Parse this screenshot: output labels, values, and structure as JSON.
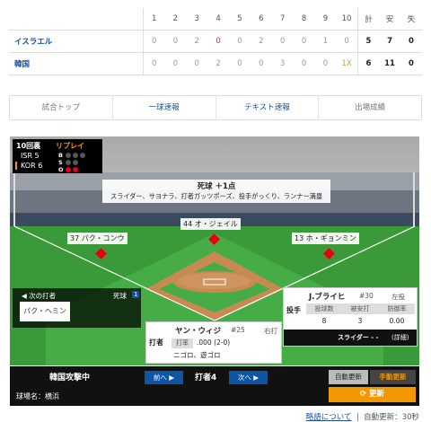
{
  "scoreboard": {
    "innings": [
      "1",
      "2",
      "3",
      "4",
      "5",
      "6",
      "7",
      "8",
      "9",
      "10"
    ],
    "totals_header": [
      "計",
      "安",
      "失"
    ],
    "rows": [
      {
        "team": "イスラエル",
        "scores": [
          "0",
          "0",
          "2",
          "0",
          "0",
          "2",
          "0",
          "0",
          "1",
          "0"
        ],
        "totals": [
          "5",
          "7",
          "0"
        ]
      },
      {
        "team": "韓国",
        "scores": [
          "0",
          "0",
          "0",
          "2",
          "0",
          "0",
          "3",
          "0",
          "0",
          "1X"
        ],
        "totals": [
          "6",
          "11",
          "0"
        ]
      }
    ]
  },
  "nav": {
    "tabs": [
      "試合トップ",
      "一球速報",
      "テキスト速報",
      "出場成績"
    ]
  },
  "field": {
    "inning_label": "10回裏",
    "replay_label": "リプレイ",
    "teams": [
      {
        "abbr": "ISR",
        "runs": "5"
      },
      {
        "abbr": "KOR",
        "runs": "6"
      }
    ],
    "count_labels": [
      "B",
      "S",
      "O"
    ],
    "count": {
      "balls": 0,
      "strikes": 0,
      "outs": 2
    },
    "play_result": "死球 ＋1点",
    "play_detail": "スライダー、サヨナラ、打者ガッツポーズ、投手がっくり、ランナー満塁",
    "runners": {
      "second": "44 オ・ジェイル",
      "first": "13 ホ・ギョンミン",
      "third": "37 パク・コンウ"
    }
  },
  "next_batter": {
    "label": "次の打者",
    "result_label": "死球",
    "result_count": "1",
    "name": "パク・ヘミン"
  },
  "pitcher": {
    "role": "投手",
    "name": "J.ブライヒ",
    "number": "#30",
    "throws": "左投",
    "stat_headers": [
      "投球数",
      "被安打",
      "防御率"
    ],
    "stats": [
      "8",
      "3",
      "0.00"
    ],
    "pitch_type": "スライダー - -",
    "detail": "(詳細)"
  },
  "batter": {
    "role": "打者",
    "name": "ヤン・ウィジ",
    "number": "#25",
    "bats": "右打",
    "avg_label": "打率",
    "avg": ".000 (2-0)",
    "results": "ニゴロ、遊ゴロ"
  },
  "bottom_bar": {
    "attack": "韓国攻撃中",
    "prev": "前へ",
    "batter_no": "打者4",
    "next": "次へ",
    "stadium": "球場名：横浜",
    "auto_update": "自動更新",
    "manual_update": "手動更新",
    "refresh": "更新"
  },
  "footer": {
    "link": "略語について",
    "auto_refresh": "自動更新：30秒"
  }
}
